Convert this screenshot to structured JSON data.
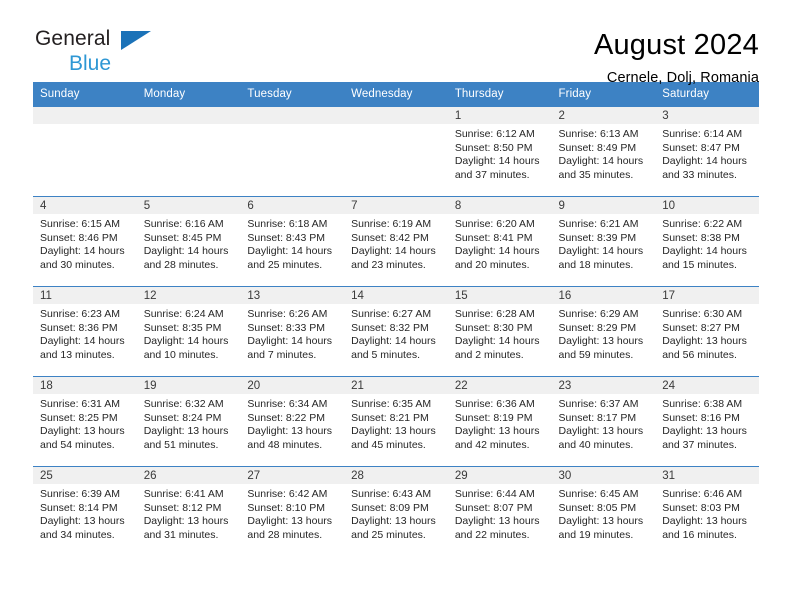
{
  "brand": {
    "name_part1": "General",
    "name_part2": "Blue",
    "triangle_color": "#1b72b8",
    "blue_text_color": "#2e97d4"
  },
  "header": {
    "title": "August 2024",
    "subtitle": "Cernele, Dolj, Romania"
  },
  "theme": {
    "header_row_bg": "#3d82c4",
    "header_row_text": "#ffffff",
    "daynum_band_bg": "#f0f0f0",
    "cell_border": "#3d82c4",
    "cell_bg": "#ffffff",
    "body_text": "#262626"
  },
  "weekday_headers": [
    "Sunday",
    "Monday",
    "Tuesday",
    "Wednesday",
    "Thursday",
    "Friday",
    "Saturday"
  ],
  "weeks": [
    [
      {
        "day": "",
        "sunrise": "",
        "sunset": "",
        "daylight_line1": "",
        "daylight_line2": ""
      },
      {
        "day": "",
        "sunrise": "",
        "sunset": "",
        "daylight_line1": "",
        "daylight_line2": ""
      },
      {
        "day": "",
        "sunrise": "",
        "sunset": "",
        "daylight_line1": "",
        "daylight_line2": ""
      },
      {
        "day": "",
        "sunrise": "",
        "sunset": "",
        "daylight_line1": "",
        "daylight_line2": ""
      },
      {
        "day": "1",
        "sunrise": "Sunrise: 6:12 AM",
        "sunset": "Sunset: 8:50 PM",
        "daylight_line1": "Daylight: 14 hours",
        "daylight_line2": "and 37 minutes."
      },
      {
        "day": "2",
        "sunrise": "Sunrise: 6:13 AM",
        "sunset": "Sunset: 8:49 PM",
        "daylight_line1": "Daylight: 14 hours",
        "daylight_line2": "and 35 minutes."
      },
      {
        "day": "3",
        "sunrise": "Sunrise: 6:14 AM",
        "sunset": "Sunset: 8:47 PM",
        "daylight_line1": "Daylight: 14 hours",
        "daylight_line2": "and 33 minutes."
      }
    ],
    [
      {
        "day": "4",
        "sunrise": "Sunrise: 6:15 AM",
        "sunset": "Sunset: 8:46 PM",
        "daylight_line1": "Daylight: 14 hours",
        "daylight_line2": "and 30 minutes."
      },
      {
        "day": "5",
        "sunrise": "Sunrise: 6:16 AM",
        "sunset": "Sunset: 8:45 PM",
        "daylight_line1": "Daylight: 14 hours",
        "daylight_line2": "and 28 minutes."
      },
      {
        "day": "6",
        "sunrise": "Sunrise: 6:18 AM",
        "sunset": "Sunset: 8:43 PM",
        "daylight_line1": "Daylight: 14 hours",
        "daylight_line2": "and 25 minutes."
      },
      {
        "day": "7",
        "sunrise": "Sunrise: 6:19 AM",
        "sunset": "Sunset: 8:42 PM",
        "daylight_line1": "Daylight: 14 hours",
        "daylight_line2": "and 23 minutes."
      },
      {
        "day": "8",
        "sunrise": "Sunrise: 6:20 AM",
        "sunset": "Sunset: 8:41 PM",
        "daylight_line1": "Daylight: 14 hours",
        "daylight_line2": "and 20 minutes."
      },
      {
        "day": "9",
        "sunrise": "Sunrise: 6:21 AM",
        "sunset": "Sunset: 8:39 PM",
        "daylight_line1": "Daylight: 14 hours",
        "daylight_line2": "and 18 minutes."
      },
      {
        "day": "10",
        "sunrise": "Sunrise: 6:22 AM",
        "sunset": "Sunset: 8:38 PM",
        "daylight_line1": "Daylight: 14 hours",
        "daylight_line2": "and 15 minutes."
      }
    ],
    [
      {
        "day": "11",
        "sunrise": "Sunrise: 6:23 AM",
        "sunset": "Sunset: 8:36 PM",
        "daylight_line1": "Daylight: 14 hours",
        "daylight_line2": "and 13 minutes."
      },
      {
        "day": "12",
        "sunrise": "Sunrise: 6:24 AM",
        "sunset": "Sunset: 8:35 PM",
        "daylight_line1": "Daylight: 14 hours",
        "daylight_line2": "and 10 minutes."
      },
      {
        "day": "13",
        "sunrise": "Sunrise: 6:26 AM",
        "sunset": "Sunset: 8:33 PM",
        "daylight_line1": "Daylight: 14 hours",
        "daylight_line2": "and 7 minutes."
      },
      {
        "day": "14",
        "sunrise": "Sunrise: 6:27 AM",
        "sunset": "Sunset: 8:32 PM",
        "daylight_line1": "Daylight: 14 hours",
        "daylight_line2": "and 5 minutes."
      },
      {
        "day": "15",
        "sunrise": "Sunrise: 6:28 AM",
        "sunset": "Sunset: 8:30 PM",
        "daylight_line1": "Daylight: 14 hours",
        "daylight_line2": "and 2 minutes."
      },
      {
        "day": "16",
        "sunrise": "Sunrise: 6:29 AM",
        "sunset": "Sunset: 8:29 PM",
        "daylight_line1": "Daylight: 13 hours",
        "daylight_line2": "and 59 minutes."
      },
      {
        "day": "17",
        "sunrise": "Sunrise: 6:30 AM",
        "sunset": "Sunset: 8:27 PM",
        "daylight_line1": "Daylight: 13 hours",
        "daylight_line2": "and 56 minutes."
      }
    ],
    [
      {
        "day": "18",
        "sunrise": "Sunrise: 6:31 AM",
        "sunset": "Sunset: 8:25 PM",
        "daylight_line1": "Daylight: 13 hours",
        "daylight_line2": "and 54 minutes."
      },
      {
        "day": "19",
        "sunrise": "Sunrise: 6:32 AM",
        "sunset": "Sunset: 8:24 PM",
        "daylight_line1": "Daylight: 13 hours",
        "daylight_line2": "and 51 minutes."
      },
      {
        "day": "20",
        "sunrise": "Sunrise: 6:34 AM",
        "sunset": "Sunset: 8:22 PM",
        "daylight_line1": "Daylight: 13 hours",
        "daylight_line2": "and 48 minutes."
      },
      {
        "day": "21",
        "sunrise": "Sunrise: 6:35 AM",
        "sunset": "Sunset: 8:21 PM",
        "daylight_line1": "Daylight: 13 hours",
        "daylight_line2": "and 45 minutes."
      },
      {
        "day": "22",
        "sunrise": "Sunrise: 6:36 AM",
        "sunset": "Sunset: 8:19 PM",
        "daylight_line1": "Daylight: 13 hours",
        "daylight_line2": "and 42 minutes."
      },
      {
        "day": "23",
        "sunrise": "Sunrise: 6:37 AM",
        "sunset": "Sunset: 8:17 PM",
        "daylight_line1": "Daylight: 13 hours",
        "daylight_line2": "and 40 minutes."
      },
      {
        "day": "24",
        "sunrise": "Sunrise: 6:38 AM",
        "sunset": "Sunset: 8:16 PM",
        "daylight_line1": "Daylight: 13 hours",
        "daylight_line2": "and 37 minutes."
      }
    ],
    [
      {
        "day": "25",
        "sunrise": "Sunrise: 6:39 AM",
        "sunset": "Sunset: 8:14 PM",
        "daylight_line1": "Daylight: 13 hours",
        "daylight_line2": "and 34 minutes."
      },
      {
        "day": "26",
        "sunrise": "Sunrise: 6:41 AM",
        "sunset": "Sunset: 8:12 PM",
        "daylight_line1": "Daylight: 13 hours",
        "daylight_line2": "and 31 minutes."
      },
      {
        "day": "27",
        "sunrise": "Sunrise: 6:42 AM",
        "sunset": "Sunset: 8:10 PM",
        "daylight_line1": "Daylight: 13 hours",
        "daylight_line2": "and 28 minutes."
      },
      {
        "day": "28",
        "sunrise": "Sunrise: 6:43 AM",
        "sunset": "Sunset: 8:09 PM",
        "daylight_line1": "Daylight: 13 hours",
        "daylight_line2": "and 25 minutes."
      },
      {
        "day": "29",
        "sunrise": "Sunrise: 6:44 AM",
        "sunset": "Sunset: 8:07 PM",
        "daylight_line1": "Daylight: 13 hours",
        "daylight_line2": "and 22 minutes."
      },
      {
        "day": "30",
        "sunrise": "Sunrise: 6:45 AM",
        "sunset": "Sunset: 8:05 PM",
        "daylight_line1": "Daylight: 13 hours",
        "daylight_line2": "and 19 minutes."
      },
      {
        "day": "31",
        "sunrise": "Sunrise: 6:46 AM",
        "sunset": "Sunset: 8:03 PM",
        "daylight_line1": "Daylight: 13 hours",
        "daylight_line2": "and 16 minutes."
      }
    ]
  ]
}
